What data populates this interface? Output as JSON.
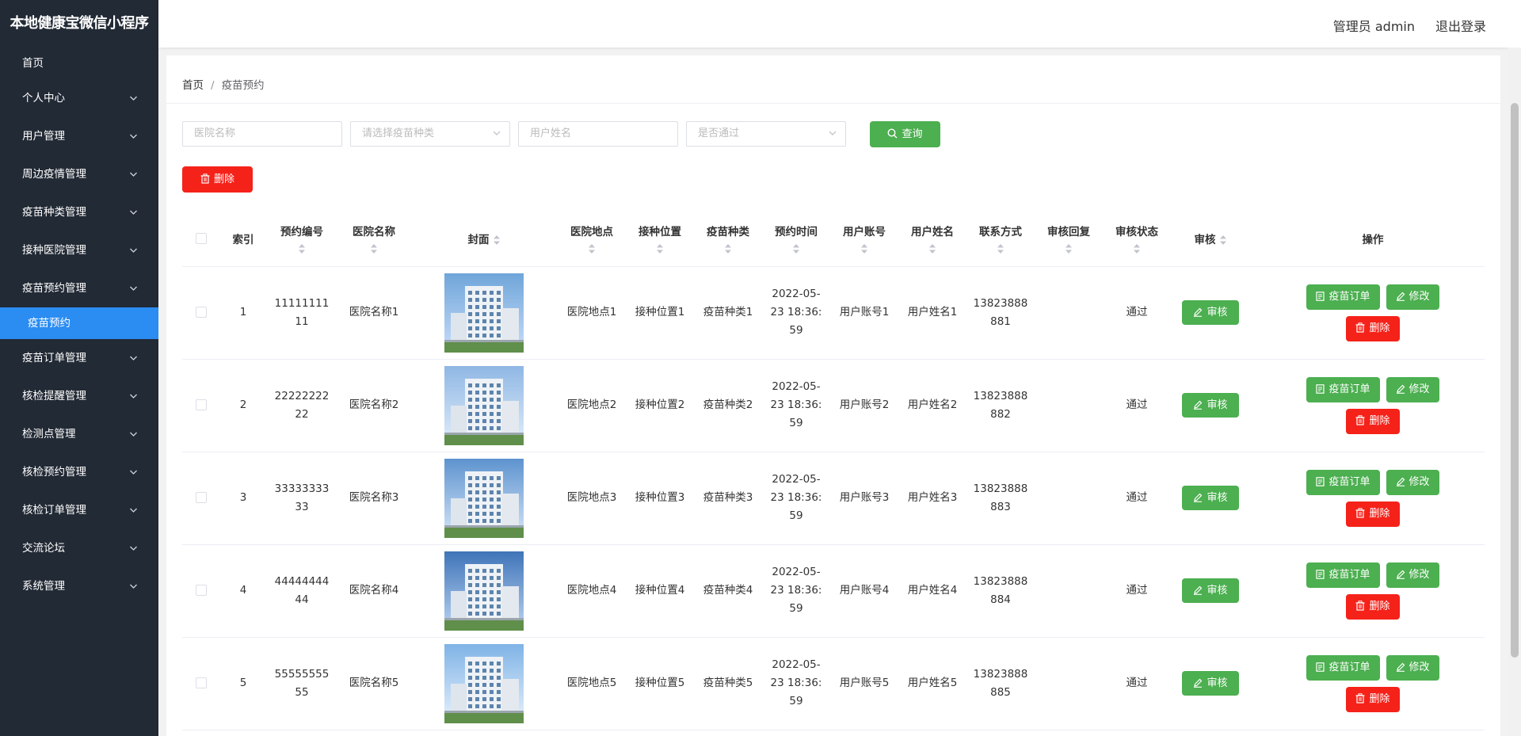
{
  "app": {
    "title": "本地健康宝微信小程序"
  },
  "sidebar": {
    "items": [
      {
        "label": "首页"
      },
      {
        "label": "个人中心"
      },
      {
        "label": "用户管理"
      },
      {
        "label": "周边疫情管理"
      },
      {
        "label": "疫苗种类管理"
      },
      {
        "label": "接种医院管理"
      },
      {
        "label": "疫苗预约管理"
      },
      {
        "label": "疫苗订单管理"
      },
      {
        "label": "核检提醒管理"
      },
      {
        "label": "检测点管理"
      },
      {
        "label": "核检预约管理"
      },
      {
        "label": "核检订单管理"
      },
      {
        "label": "交流论坛"
      },
      {
        "label": "系统管理"
      }
    ],
    "sub_item": {
      "label": "疫苗预约"
    }
  },
  "topbar": {
    "admin": "管理员 admin",
    "logout": "退出登录"
  },
  "breadcrumb": {
    "home": "首页",
    "sep": "/",
    "current": "疫苗预约"
  },
  "filters": {
    "hospital_placeholder": "医院名称",
    "vaccine_type_placeholder": "请选择疫苗种类",
    "user_name_placeholder": "用户姓名",
    "approved_placeholder": "是否通过",
    "query_label": "查询"
  },
  "toolbar": {
    "delete_label": "删除"
  },
  "table": {
    "headers": {
      "index": "索引",
      "booking_no": "预约编号",
      "hospital": "医院名称",
      "cover": "封面",
      "location": "医院地点",
      "position": "接种位置",
      "vaccine_type": "疫苗种类",
      "time": "预约时间",
      "account": "用户账号",
      "user_name": "用户姓名",
      "phone": "联系方式",
      "reply": "审核回复",
      "status": "审核状态",
      "audit": "审核",
      "ops": "操作"
    },
    "buttons": {
      "audit": "审核",
      "order": "疫苗订单",
      "edit": "修改",
      "delete": "删除"
    },
    "rows": [
      {
        "index": "1",
        "booking_no": "1111111111",
        "hospital": "医院名称1",
        "location": "医院地点1",
        "position": "接种位置1",
        "vaccine_type": "疫苗种类1",
        "time": "2022-05-23 18:36:59",
        "account": "用户账号1",
        "user_name": "用户姓名1",
        "phone": "13823888881",
        "reply": "",
        "status": "通过"
      },
      {
        "index": "2",
        "booking_no": "2222222222",
        "hospital": "医院名称2",
        "location": "医院地点2",
        "position": "接种位置2",
        "vaccine_type": "疫苗种类2",
        "time": "2022-05-23 18:36:59",
        "account": "用户账号2",
        "user_name": "用户姓名2",
        "phone": "13823888882",
        "reply": "",
        "status": "通过"
      },
      {
        "index": "3",
        "booking_no": "3333333333",
        "hospital": "医院名称3",
        "location": "医院地点3",
        "position": "接种位置3",
        "vaccine_type": "疫苗种类3",
        "time": "2022-05-23 18:36:59",
        "account": "用户账号3",
        "user_name": "用户姓名3",
        "phone": "13823888883",
        "reply": "",
        "status": "通过"
      },
      {
        "index": "4",
        "booking_no": "4444444444",
        "hospital": "医院名称4",
        "location": "医院地点4",
        "position": "接种位置4",
        "vaccine_type": "疫苗种类4",
        "time": "2022-05-23 18:36:59",
        "account": "用户账号4",
        "user_name": "用户姓名4",
        "phone": "13823888884",
        "reply": "",
        "status": "通过"
      },
      {
        "index": "5",
        "booking_no": "5555555555",
        "hospital": "医院名称5",
        "location": "医院地点5",
        "position": "接种位置5",
        "vaccine_type": "疫苗种类5",
        "time": "2022-05-23 18:36:59",
        "account": "用户账号5",
        "user_name": "用户姓名5",
        "phone": "13823888885",
        "reply": "",
        "status": "通过"
      }
    ]
  },
  "colors": {
    "sidebar_bg": "#222a35",
    "active_blue": "#2b8cf2",
    "green": "#4caf50",
    "red": "#f5221a"
  }
}
